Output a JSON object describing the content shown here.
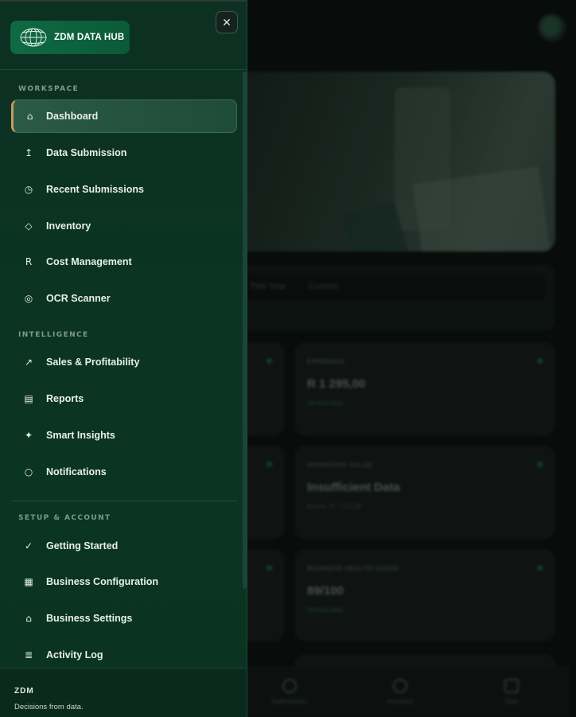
{
  "app": {
    "logo_text": "ZDM DATA HUB"
  },
  "sidebar": {
    "close_label": "✕",
    "sections": [
      {
        "label": "WORKSPACE",
        "items": [
          {
            "label": "Dashboard",
            "icon": "⌂",
            "icon_name": "home-icon",
            "active": true
          },
          {
            "label": "Data Submission",
            "icon": "↥",
            "icon_name": "upload-icon"
          },
          {
            "label": "Recent Submissions",
            "icon": "◷",
            "icon_name": "clock-icon"
          },
          {
            "label": "Inventory",
            "icon": "◇",
            "icon_name": "box-icon"
          },
          {
            "label": "Cost Management",
            "icon": "R",
            "icon_name": "rand-icon"
          },
          {
            "label": "OCR Scanner",
            "icon": "◎",
            "icon_name": "scan-icon"
          }
        ]
      },
      {
        "label": "INTELLIGENCE",
        "items": [
          {
            "label": "Sales & Profitability",
            "icon": "↗",
            "icon_name": "trend-up-icon"
          },
          {
            "label": "Reports",
            "icon": "▤",
            "icon_name": "report-icon"
          },
          {
            "label": "Smart Insights",
            "icon": "✦",
            "icon_name": "sparkle-icon"
          },
          {
            "label": "Notifications",
            "icon": "○",
            "icon_name": "bell-icon"
          }
        ]
      },
      {
        "label": "SETUP & ACCOUNT",
        "items": [
          {
            "label": "Getting Started",
            "icon": "✓",
            "icon_name": "check-icon"
          },
          {
            "label": "Business Configuration",
            "icon": "▦",
            "icon_name": "grid-icon"
          },
          {
            "label": "Business Settings",
            "icon": "⌂",
            "icon_name": "building-icon"
          },
          {
            "label": "Activity Log",
            "icon": "≣",
            "icon_name": "list-icon"
          }
        ]
      }
    ],
    "footer": {
      "brand": "ZDM",
      "tagline": "Decisions from data."
    }
  },
  "background": {
    "filters": [
      "This Year",
      "Custom"
    ],
    "cards": [
      {
        "label": "EXPENSES",
        "value": "R 1 295,00",
        "sub": "Verified data"
      },
      {
        "label": "INVENTORY VALUE",
        "value": "Insufficient Data",
        "sub": "Known: R 7 212,00"
      },
      {
        "label": "BUSINESS HEALTH SCORE",
        "value": "89/100",
        "sub": "Verified data"
      }
    ],
    "bottom_nav": [
      "Submissions",
      "Inventory",
      "Data"
    ]
  }
}
